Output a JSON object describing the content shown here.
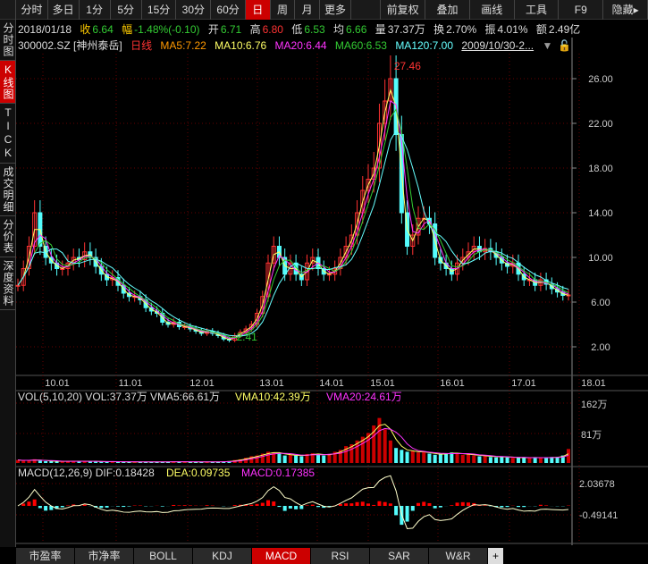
{
  "toolbar": {
    "left": [
      "分时",
      "多日",
      "1分",
      "5分",
      "15分",
      "30分",
      "60分",
      "日",
      "周",
      "月",
      "更多"
    ],
    "active": "日",
    "right": [
      "前复权",
      "叠加",
      "画线",
      "工具",
      "F9",
      "隐藏▸"
    ]
  },
  "sidebar": [
    {
      "label": "分时图"
    },
    {
      "label": "K线图",
      "active": true
    },
    {
      "label": "TICK"
    },
    {
      "label": "成交明细"
    },
    {
      "label": "分价表"
    },
    {
      "label": "深度资料"
    }
  ],
  "info": {
    "date": "2018/01/18",
    "close_l": "收",
    "close": "6.64",
    "chg_l": "幅",
    "chg": "-1.48%(-0.10)",
    "open_l": "开",
    "open": "6.71",
    "high_l": "高",
    "high": "6.80",
    "low_l": "低",
    "low": "6.53",
    "avg_l": "均",
    "avg": "6.66",
    "vol_l": "量",
    "vol": "37.37万",
    "turn_l": "换",
    "turn": "2.70%",
    "amp_l": "振",
    "amp": "4.01%",
    "amt_l": "额",
    "amt": "2.49亿"
  },
  "legend": {
    "code": "300002.SZ [神州泰岳]",
    "period": "日线",
    "ma5": "MA5:7.22",
    "ma10": "MA10:6.76",
    "ma20": "MA20:6.44",
    "ma60": "MA60:6.53",
    "ma120": "MA120:7.00",
    "range": "2009/10/30-2..."
  },
  "colors": {
    "up": "#ff3232",
    "down": "#54fcfc",
    "ma5": "#ff9900",
    "ma10": "#ffff66",
    "ma20": "#ff33ff",
    "ma60": "#33cc33",
    "ma120": "#66ffff"
  },
  "chart_data": {
    "type": "line",
    "title": "300002.SZ 日线",
    "price_axis": [
      "26.00",
      "22.00",
      "18.00",
      "14.00",
      "10.00",
      "6.00",
      "2.00"
    ],
    "ylim": [
      2,
      26
    ],
    "dates": [
      "10.01",
      "11.01",
      "12.01",
      "13.01",
      "14.01",
      "15.01",
      "16.01",
      "17.01",
      "18.01"
    ],
    "annotations": {
      "high": "27.46",
      "low": "2.41"
    },
    "close_monthly": [
      7.5,
      9,
      11,
      14,
      11,
      10,
      9.5,
      9,
      9,
      9.5,
      10,
      9.8,
      10.5,
      10,
      9.2,
      8.5,
      8,
      8.2,
      7.5,
      6.8,
      6.5,
      6.5,
      6.2,
      5.5,
      5.2,
      5,
      4.2,
      4,
      4.2,
      3.8,
      3.8,
      3.6,
      3.4,
      3.2,
      3.4,
      3.2,
      3,
      2.7,
      2.6,
      3,
      3.3,
      3.6,
      4,
      5,
      6.5,
      9.5,
      11,
      10,
      8.5,
      9.5,
      8.5,
      8,
      9.5,
      10,
      9,
      8.5,
      8.5,
      9,
      10,
      11,
      12,
      14,
      16,
      17,
      18,
      22,
      24,
      26,
      21,
      14,
      11,
      12,
      13.5,
      13.5,
      13,
      10,
      9.5,
      9,
      8.5,
      9.5,
      10,
      10.5,
      11,
      10.5,
      10.8,
      10.5,
      10,
      9.5,
      9.2,
      9.5,
      8.5,
      8,
      8,
      7.5,
      8,
      7.6,
      7.2,
      6.9,
      6.6,
      6.64
    ],
    "volume_monthly_wan": [
      8,
      6,
      7,
      10,
      6,
      5,
      5,
      4,
      4,
      5,
      5,
      4,
      5,
      4,
      4,
      4,
      3,
      4,
      3,
      3,
      3,
      3,
      3,
      3,
      3,
      3,
      3,
      3,
      4,
      3,
      3,
      3,
      3,
      3,
      3,
      3,
      3,
      4,
      5,
      8,
      10,
      14,
      18,
      20,
      25,
      30,
      28,
      25,
      20,
      22,
      20,
      18,
      24,
      26,
      22,
      20,
      24,
      30,
      35,
      45,
      50,
      60,
      70,
      80,
      100,
      120,
      90,
      60,
      40,
      35,
      30,
      32,
      28,
      30,
      25,
      22,
      24,
      26,
      28,
      25,
      22,
      24,
      20,
      18,
      20,
      16,
      15,
      18,
      15,
      14,
      14,
      15,
      14,
      15,
      14,
      14,
      16,
      16,
      20,
      37.37
    ],
    "vol_title": "VOL(5,10,20)",
    "vol": "VOL:37.37万",
    "vma5": "VMA5:66.61万",
    "vma10": "VMA10:42.39万",
    "vma20": "VMA20:24.61万",
    "vol_axis": [
      "162万",
      "81万"
    ],
    "macd_title": "MACD(12,26,9)",
    "dif": "DIF:0.18428",
    "dea": "DEA:0.09735",
    "macd": "MACD:0.17385",
    "macd_axis": [
      "2.03678",
      "-0.49141"
    ]
  },
  "tabs": [
    "市盈率",
    "市净率",
    "BOLL",
    "KDJ",
    "MACD",
    "RSI",
    "SAR",
    "W&R",
    "+"
  ],
  "active_tab": "MACD"
}
